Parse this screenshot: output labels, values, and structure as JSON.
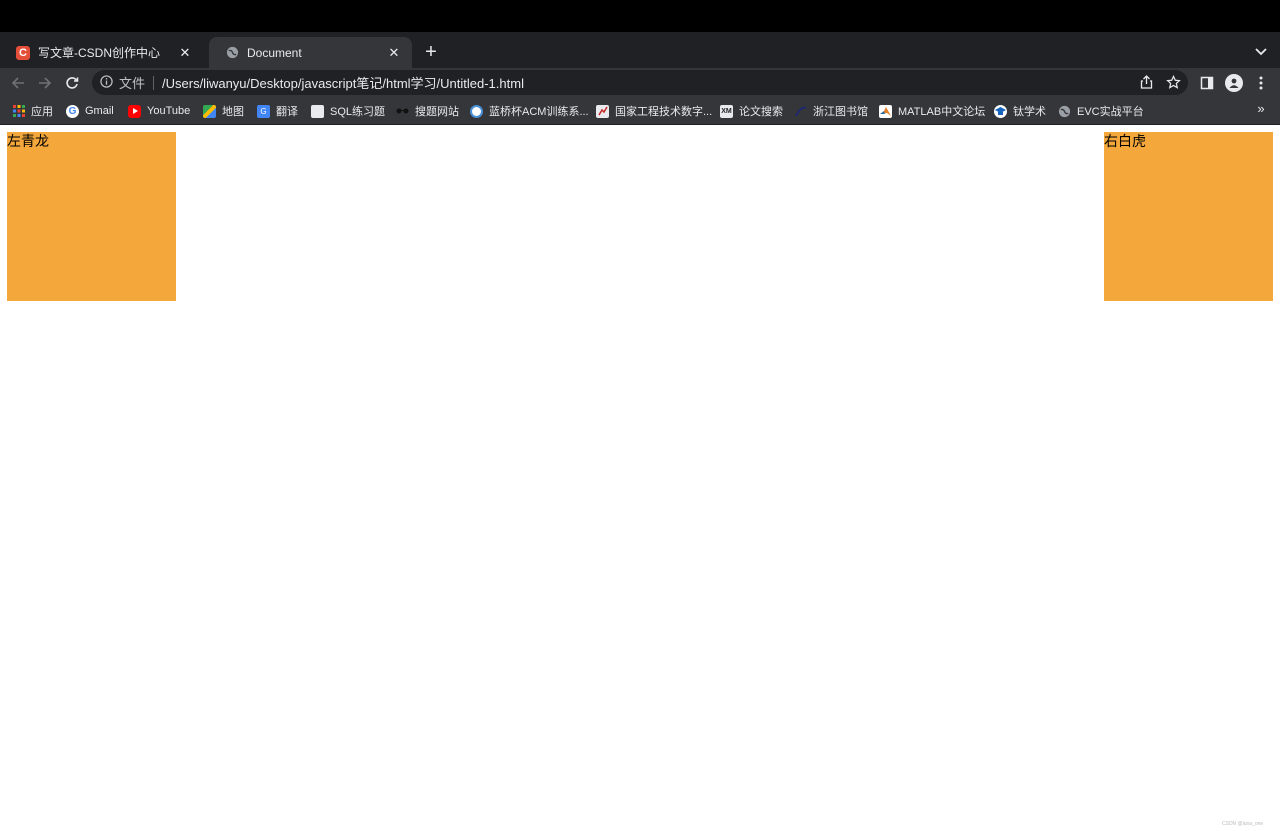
{
  "browser": {
    "tabs": [
      {
        "title": "写文章-CSDN创作中心",
        "favicon": "csdn-logo-icon",
        "active": false
      },
      {
        "title": "Document",
        "favicon": "globe-icon",
        "active": true
      }
    ],
    "address": {
      "scheme_label": "文件",
      "url": "/Users/liwanyu/Desktop/javascript笔记/html学习/Untitled-1.html"
    },
    "bookmarks": [
      {
        "label": "应用",
        "icon": "apps-grid-icon",
        "color": "#ea4335"
      },
      {
        "label": "Gmail",
        "icon": "google-g-icon",
        "color": "#4285f4"
      },
      {
        "label": "YouTube",
        "icon": "youtube-icon",
        "color": "#ff0000"
      },
      {
        "label": "地图",
        "icon": "maps-icon",
        "color": "#34a853"
      },
      {
        "label": "翻译",
        "icon": "translate-icon",
        "color": "#4285f4"
      },
      {
        "label": "SQL练习题",
        "icon": "page-icon",
        "color": "#e8eaed"
      },
      {
        "label": "搜题网站",
        "icon": "glasses-icon",
        "color": "#111111"
      },
      {
        "label": "蓝桥杯ACM训练系...",
        "icon": "circle-logo-icon",
        "color": "#4a90d9"
      },
      {
        "label": "国家工程技术数字...",
        "icon": "chart-logo-icon",
        "color": "#e8eaed"
      },
      {
        "label": "论文搜索",
        "icon": "xm-logo-icon",
        "color": "#e8eaed"
      },
      {
        "label": "浙江图书馆",
        "icon": "library-logo-icon",
        "color": "#1a237e"
      },
      {
        "label": "MATLAB中文论坛",
        "icon": "matlab-icon",
        "color": "#e67e22"
      },
      {
        "label": "钛学术",
        "icon": "graduation-cap-icon",
        "color": "#1565c0"
      },
      {
        "label": "EVC实战平台",
        "icon": "globe-icon",
        "color": "#9aa0a6"
      }
    ]
  },
  "page": {
    "left_box_text": "左青龙",
    "right_box_text": "右白虎",
    "box_color": "#f4a83b"
  },
  "watermark": "CSDN @luna_one"
}
